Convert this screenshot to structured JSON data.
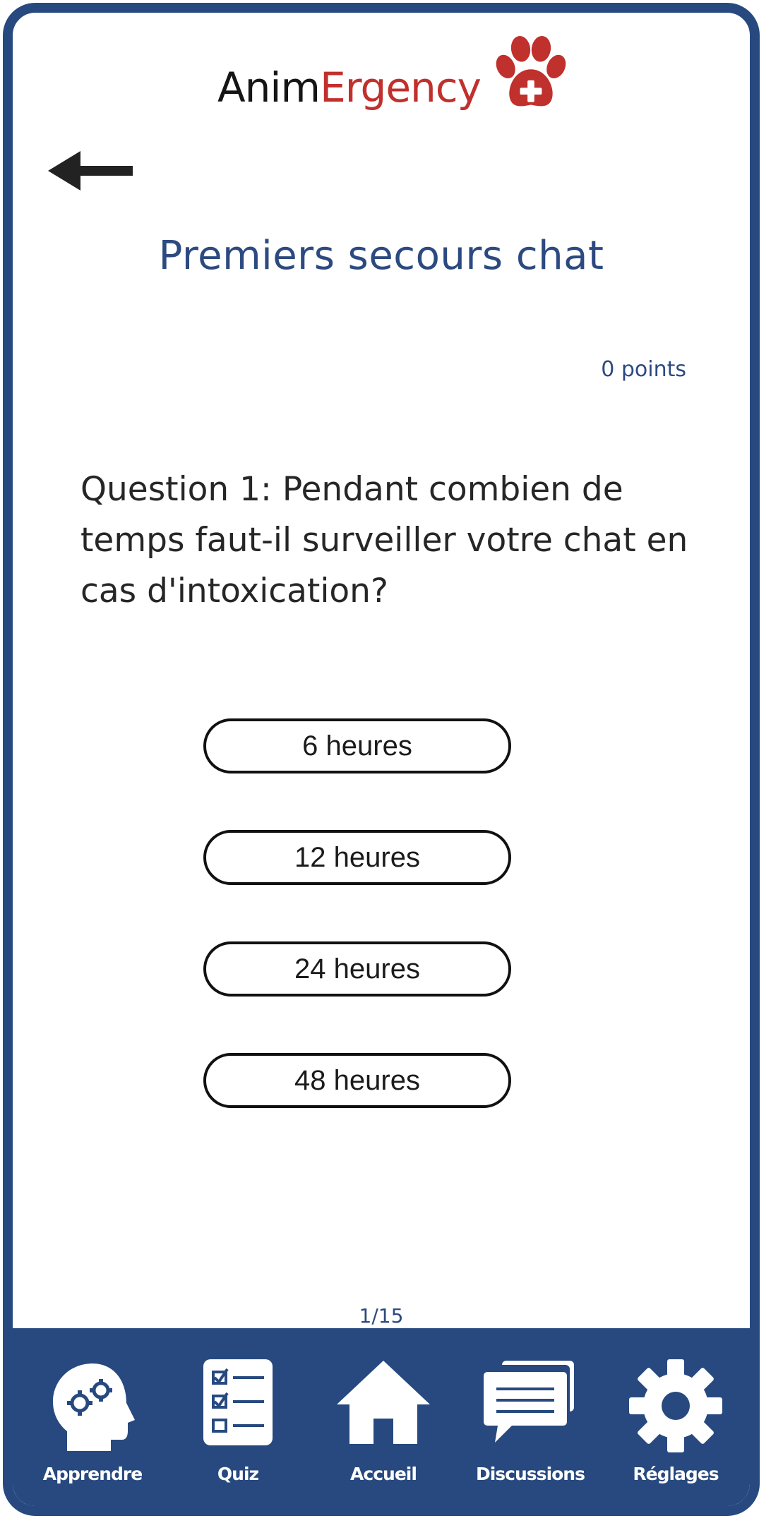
{
  "app": {
    "brand_part1": "Anim",
    "brand_part2": "Ergency",
    "brand_color": "#c0302c",
    "accent_color": "#27497f"
  },
  "header": {
    "back_icon": "left-arrow-icon",
    "title": "Premiers secours chat",
    "points": "0 points"
  },
  "quiz": {
    "question": "Question 1: Pendant combien de temps faut-il surveiller votre chat en cas d'intoxication?",
    "answers": [
      "6 heures",
      "12 heures",
      "24 heures",
      "48 heures"
    ],
    "progress": "1/15"
  },
  "navbar": {
    "items": [
      {
        "label": "Apprendre",
        "icon": "head-gears-icon"
      },
      {
        "label": "Quiz",
        "icon": "checklist-icon"
      },
      {
        "label": "Accueil",
        "icon": "home-icon"
      },
      {
        "label": "Discussions",
        "icon": "chat-bubbles-icon"
      },
      {
        "label": "Réglages",
        "icon": "gear-icon"
      }
    ]
  }
}
